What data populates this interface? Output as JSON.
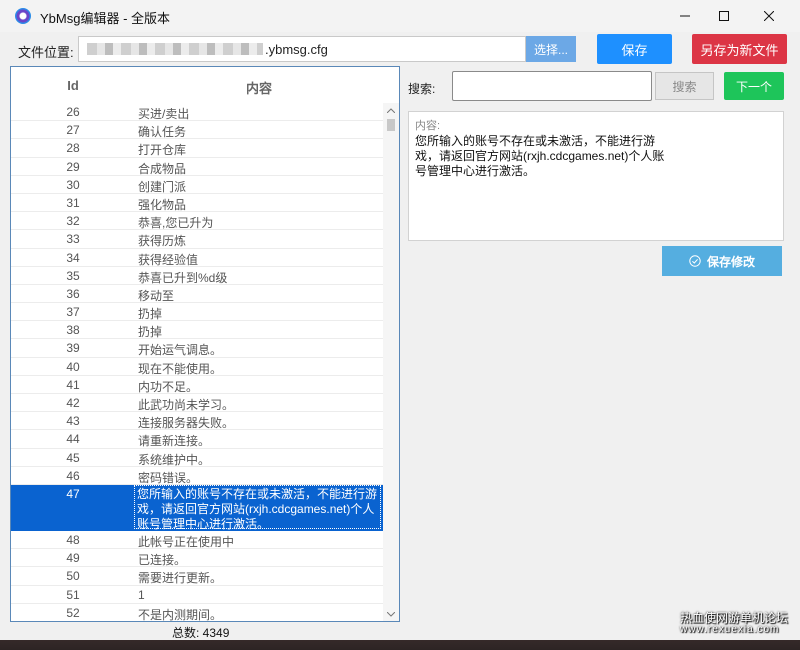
{
  "window": {
    "title": "YbMsg编辑器 - 全版本"
  },
  "toolbar": {
    "file_label": "文件位置:",
    "file_value": ".ybmsg.cfg",
    "choose_label": "选择...",
    "save_label": "保存",
    "save_as_label": "另存为新文件"
  },
  "table": {
    "headers": {
      "id": "Id",
      "content": "内容"
    },
    "rows": [
      {
        "id": "26",
        "text": "买进/卖出"
      },
      {
        "id": "27",
        "text": "确认任务"
      },
      {
        "id": "28",
        "text": "打开仓库"
      },
      {
        "id": "29",
        "text": "合成物品"
      },
      {
        "id": "30",
        "text": "创建门派"
      },
      {
        "id": "31",
        "text": "强化物品"
      },
      {
        "id": "32",
        "text": "恭喜,您已升为"
      },
      {
        "id": "33",
        "text": "获得历炼"
      },
      {
        "id": "34",
        "text": "获得经验值"
      },
      {
        "id": "35",
        "text": "恭喜已升到%d级"
      },
      {
        "id": "36",
        "text": "移动至"
      },
      {
        "id": "37",
        "text": "扔掉"
      },
      {
        "id": "38",
        "text": "扔掉"
      },
      {
        "id": "39",
        "text": "开始运气调息。"
      },
      {
        "id": "40",
        "text": "现在不能使用。"
      },
      {
        "id": "41",
        "text": "内功不足。"
      },
      {
        "id": "42",
        "text": "此武功尚未学习。"
      },
      {
        "id": "43",
        "text": "连接服务器失败。"
      },
      {
        "id": "44",
        "text": "请重新连接。"
      },
      {
        "id": "45",
        "text": "系统维护中。"
      },
      {
        "id": "46",
        "text": "密码错误。"
      },
      {
        "id": "47",
        "text": "您所输入的账号不存在或未激活，不能进行游戏，请返回官方网站(rxjh.cdcgames.net)个人账号管理中心进行激活。",
        "selected": true
      },
      {
        "id": "48",
        "text": "此帐号正在使用中"
      },
      {
        "id": "49",
        "text": "已连接。"
      },
      {
        "id": "50",
        "text": "需要进行更新。"
      },
      {
        "id": "51",
        "text": "1"
      },
      {
        "id": "52",
        "text": "不是内测期间。"
      }
    ],
    "total_label": "总数: 4349"
  },
  "search": {
    "label": "搜索:",
    "value": "",
    "button_label": "搜索",
    "next_label": "下一个"
  },
  "editor": {
    "label": "内容:",
    "text": "您所输入的账号不存在或未激活，不能进行游戏，请返回官方网站(rxjh.cdcgames.net)个人账号管理中心进行激活。",
    "save_changes_label": "保存修改"
  },
  "watermark": {
    "line1": "热血使网游单机论坛",
    "line2": "www.rexuexia.com"
  },
  "colors": {
    "primary": "#1e90ff",
    "danger": "#dc3545",
    "success": "#1ec55a",
    "selection": "#0a63d0",
    "info": "#55aee0"
  }
}
